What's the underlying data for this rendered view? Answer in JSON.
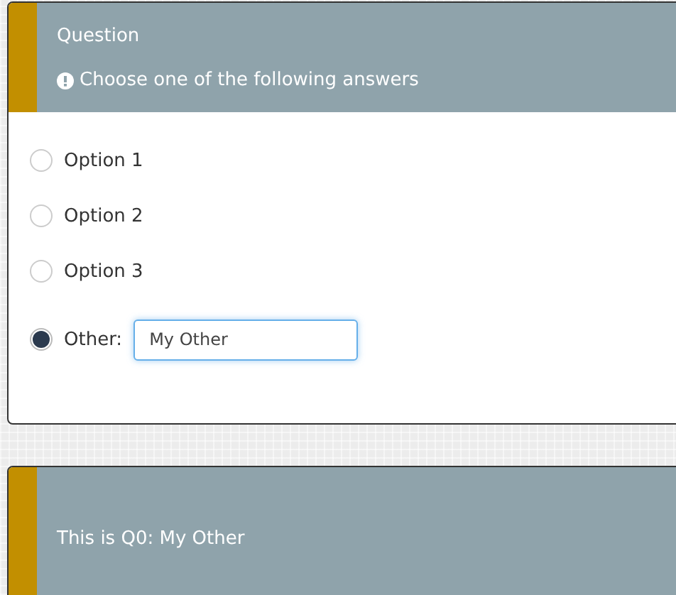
{
  "question": {
    "title": "Question",
    "hint": "Choose one of the following answers",
    "options": [
      {
        "label": "Option 1",
        "selected": false,
        "kind": "plain"
      },
      {
        "label": "Option 2",
        "selected": false,
        "kind": "plain"
      },
      {
        "label": "Option 3",
        "selected": false,
        "kind": "plain"
      },
      {
        "label": "Other:",
        "selected": true,
        "kind": "other",
        "value": "My Other"
      }
    ]
  },
  "result": {
    "text": "This is Q0: My Other"
  }
}
